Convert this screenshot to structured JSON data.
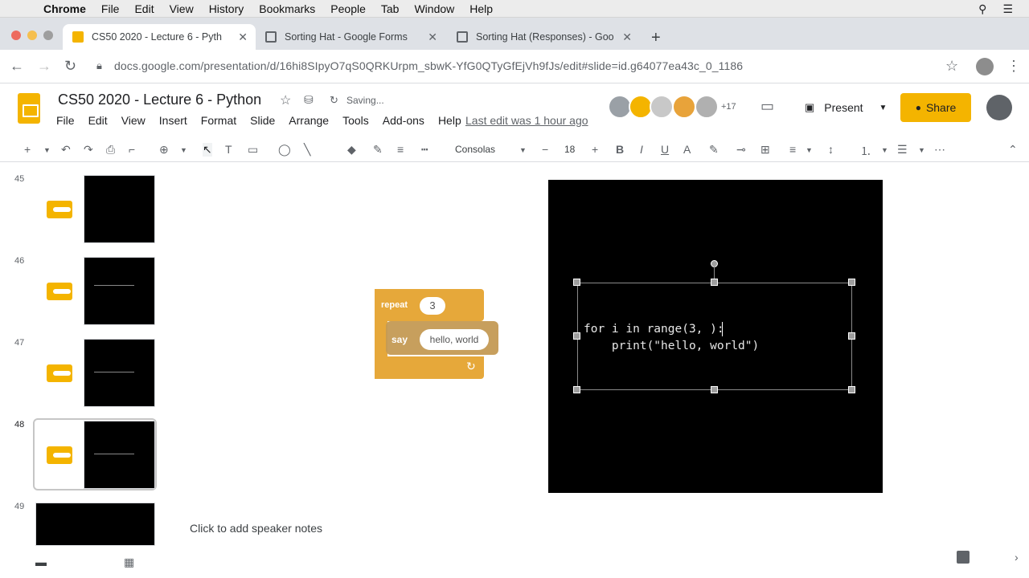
{
  "menubar": {
    "app": "Chrome",
    "items": [
      "File",
      "Edit",
      "View",
      "History",
      "Bookmarks",
      "People",
      "Tab",
      "Window",
      "Help"
    ]
  },
  "tabs": [
    {
      "title": "CS50 2020 - Lecture 6 - Pyth",
      "favicon_color": "#f4b400"
    },
    {
      "title": "Sorting Hat - Google Forms",
      "favicon_color": "#7e57c2"
    },
    {
      "title": "Sorting Hat (Responses) - Goo",
      "favicon_color": "#0f9d58"
    }
  ],
  "address": {
    "url": "docs.google.com/presentation/d/16hi8SIpyO7qS0QRKUrpm_sbwK-YfG0QTyGfEjVh9fJs/edit#slide=id.g64077ea43c_0_1186"
  },
  "doc": {
    "title": "CS50 2020 - Lecture 6 - Python",
    "saving": "Saving...",
    "menus": [
      "File",
      "Edit",
      "View",
      "Insert",
      "Format",
      "Slide",
      "Arrange",
      "Tools",
      "Add-ons",
      "Help"
    ],
    "last_edit": "Last edit was 1 hour ago",
    "collaborators_extra": "+17",
    "present_label": "Present",
    "share_label": "Share"
  },
  "toolbar": {
    "font": "Consolas",
    "font_size": "18"
  },
  "filmstrip": {
    "slides": [
      "45",
      "46",
      "47",
      "48",
      "49"
    ],
    "selected": "48"
  },
  "scratch": {
    "repeat_label": "repeat",
    "repeat_count": "3",
    "say_label": "say",
    "say_text": "hello, world"
  },
  "slide": {
    "code_line1": "for i in range(3, ):",
    "code_line2": "    print(\"hello, world\")"
  },
  "notes": {
    "placeholder": "Click to add speaker notes"
  },
  "colors": {
    "accent": "#f4b400",
    "scratch_orange": "#e6a83a"
  }
}
